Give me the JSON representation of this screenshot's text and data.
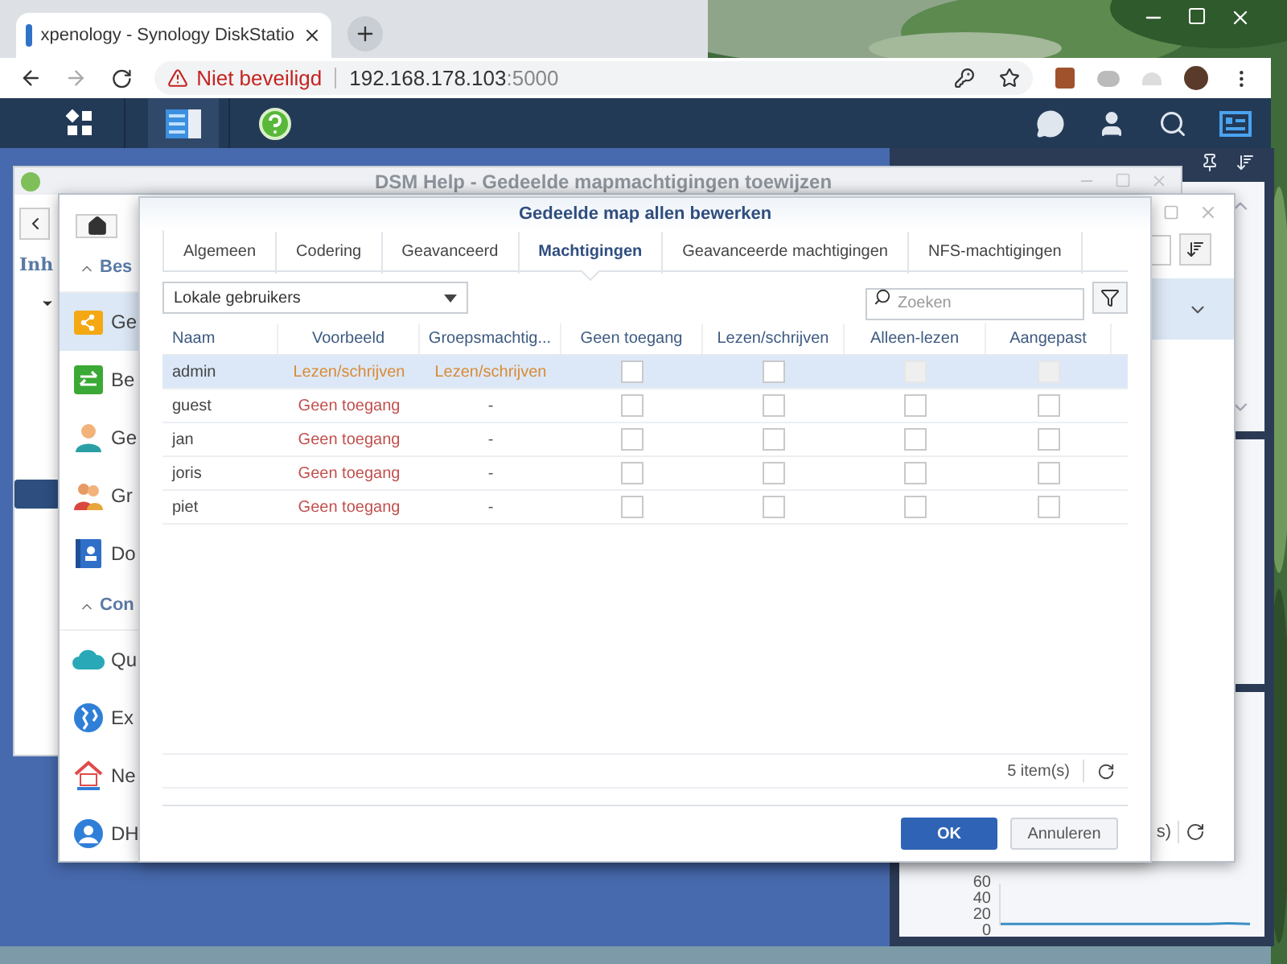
{
  "browser": {
    "tab": {
      "title": "xpenology - Synology DiskStatio"
    },
    "security": "Niet beveiligd",
    "url_host": "192.168.178.103",
    "url_port": ":5000"
  },
  "help_window": {
    "title": "DSM Help - Gedeelde mapmachtigingen toewijzen",
    "section": "Inh"
  },
  "control_panel": {
    "sidebar": [
      {
        "kind": "header",
        "label": "Bes"
      },
      {
        "kind": "item",
        "label": "Ge",
        "selected": true
      },
      {
        "kind": "item",
        "label": "Be",
        "selected": false
      },
      {
        "kind": "item",
        "label": "Ge",
        "selected": false
      },
      {
        "kind": "item",
        "label": "Gr",
        "selected": false
      },
      {
        "kind": "item",
        "label": "Do",
        "selected": false
      },
      {
        "kind": "header",
        "label": "Con"
      },
      {
        "kind": "item",
        "label": "Qu",
        "selected": false
      },
      {
        "kind": "item",
        "label": "Ex",
        "selected": false
      },
      {
        "kind": "item",
        "label": "Ne",
        "selected": false
      },
      {
        "kind": "item",
        "label": "DH",
        "selected": false
      }
    ],
    "footer_count": "s)"
  },
  "dialog": {
    "title": "Gedeelde map allen bewerken",
    "tabs": [
      {
        "label": "Algemeen",
        "selected": false
      },
      {
        "label": "Codering",
        "selected": false
      },
      {
        "label": "Geavanceerd",
        "selected": false
      },
      {
        "label": "Machtigingen",
        "selected": true
      },
      {
        "label": "Geavanceerde machtigingen",
        "selected": false
      },
      {
        "label": "NFS-machtigingen",
        "selected": false
      }
    ],
    "user_type": "Lokale gebruikers",
    "search": {
      "placeholder": "Zoeken"
    },
    "columns": [
      "Naam",
      "Voorbeeld",
      "Groepsmachtig...",
      "Geen toegang",
      "Lezen/schrijven",
      "Alleen-lezen",
      "Aangepast"
    ],
    "rows": [
      {
        "name": "admin",
        "selected": true,
        "preview": {
          "text": "Lezen/schrijven",
          "color": "#d98a35"
        },
        "group": {
          "text": "Lezen/schrijven",
          "color": "#d98a35"
        },
        "permissions": [
          {
            "checked": false,
            "disabled": false
          },
          {
            "checked": false,
            "disabled": false
          },
          {
            "checked": false,
            "disabled": true
          },
          {
            "checked": false,
            "disabled": true
          }
        ]
      },
      {
        "name": "guest",
        "selected": false,
        "preview": {
          "text": "Geen toegang",
          "color": "#c0504d"
        },
        "group": {
          "text": "-",
          "color": "#555555"
        },
        "permissions": [
          {
            "checked": false,
            "disabled": false
          },
          {
            "checked": false,
            "disabled": false
          },
          {
            "checked": false,
            "disabled": false
          },
          {
            "checked": false,
            "disabled": false
          }
        ]
      },
      {
        "name": "jan",
        "selected": false,
        "preview": {
          "text": "Geen toegang",
          "color": "#c0504d"
        },
        "group": {
          "text": "-",
          "color": "#555555"
        },
        "permissions": [
          {
            "checked": false,
            "disabled": false
          },
          {
            "checked": false,
            "disabled": false
          },
          {
            "checked": false,
            "disabled": false
          },
          {
            "checked": false,
            "disabled": false
          }
        ]
      },
      {
        "name": "joris",
        "selected": false,
        "preview": {
          "text": "Geen toegang",
          "color": "#c0504d"
        },
        "group": {
          "text": "-",
          "color": "#555555"
        },
        "permissions": [
          {
            "checked": false,
            "disabled": false
          },
          {
            "checked": false,
            "disabled": false
          },
          {
            "checked": false,
            "disabled": false
          },
          {
            "checked": false,
            "disabled": false
          }
        ]
      },
      {
        "name": "piet",
        "selected": false,
        "preview": {
          "text": "Geen toegang",
          "color": "#c0504d"
        },
        "group": {
          "text": "-",
          "color": "#555555"
        },
        "permissions": [
          {
            "checked": false,
            "disabled": false
          },
          {
            "checked": false,
            "disabled": false
          },
          {
            "checked": false,
            "disabled": false
          },
          {
            "checked": false,
            "disabled": false
          }
        ]
      }
    ],
    "item_count": "5 item(s)",
    "buttons": [
      "OK",
      "Annuleren"
    ]
  },
  "widget": {
    "chart_data": {
      "type": "line",
      "yticks": [
        0,
        20,
        40,
        60
      ],
      "ylim": [
        0,
        60
      ],
      "series": [
        {
          "color": "#3a8fc4",
          "values": [
            2,
            2,
            2,
            2,
            2,
            2,
            2,
            2,
            2,
            2,
            2,
            3,
            2
          ]
        }
      ]
    }
  }
}
